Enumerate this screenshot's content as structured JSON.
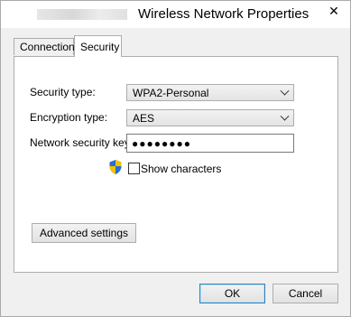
{
  "window": {
    "title": "Wireless Network Properties",
    "close_glyph": "✕"
  },
  "tabs": [
    {
      "label": "Connection",
      "active": false
    },
    {
      "label": "Security",
      "active": true
    }
  ],
  "security": {
    "security_type_label": "Security type:",
    "security_type_value": "WPA2-Personal",
    "encryption_type_label": "Encryption type:",
    "encryption_type_value": "AES",
    "key_label": "Network security key",
    "key_value_masked": "●●●●●●●●",
    "show_characters_label": "Show characters",
    "show_characters_checked": false,
    "advanced_button": "Advanced settings"
  },
  "footer": {
    "ok_label": "OK",
    "cancel_label": "Cancel"
  },
  "colors": {
    "panel_bg": "#ffffff",
    "dialog_bg": "#f0f0f0",
    "ok_border": "#3c7fb1"
  }
}
